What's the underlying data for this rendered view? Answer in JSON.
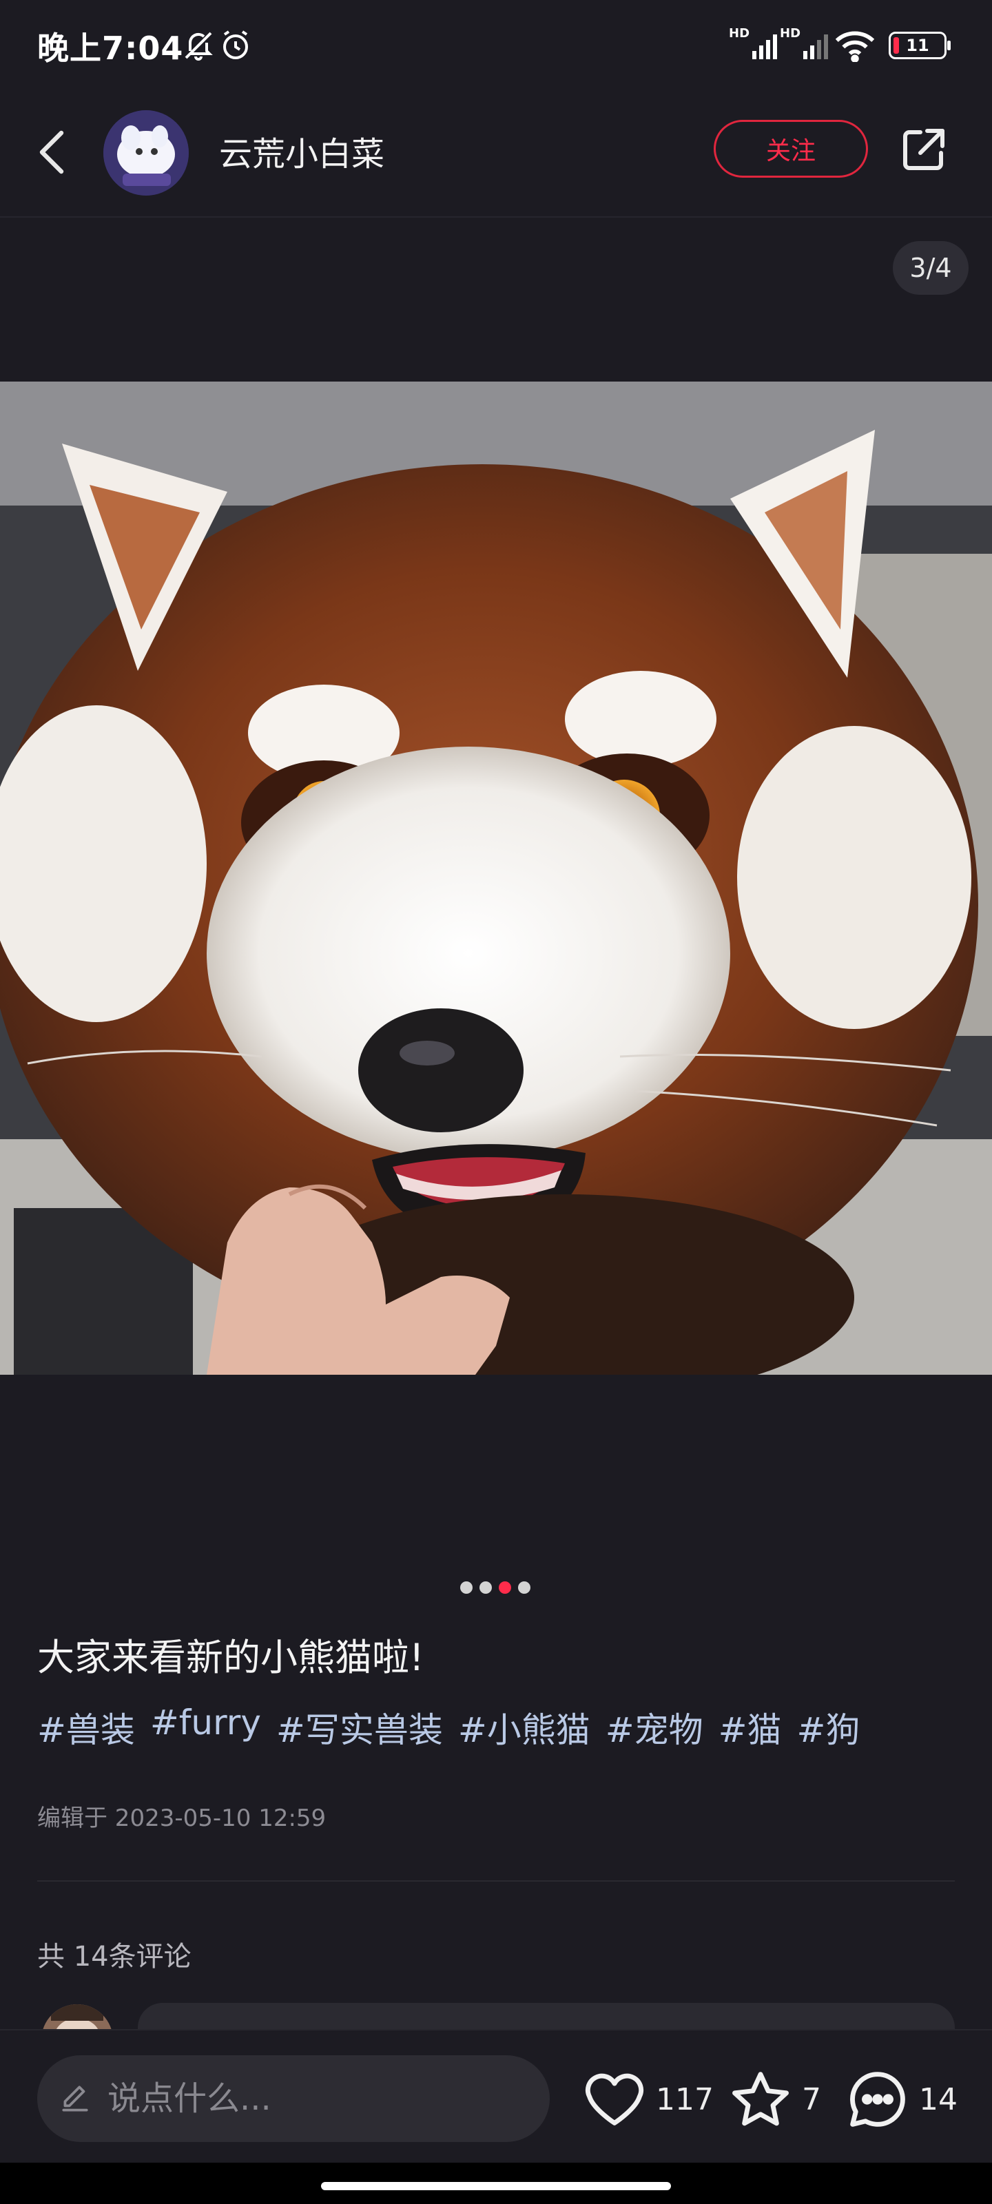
{
  "status": {
    "time": "晚上7:04",
    "network1": "HD",
    "network2": "HD",
    "battery": "11"
  },
  "header": {
    "author": "云荒小白菜",
    "follow_label": "关注"
  },
  "image": {
    "counter": "3/4",
    "current": 3,
    "total": 4
  },
  "post": {
    "title": "大家来看新的小熊猫啦!",
    "tags": [
      "#兽装",
      "#furry",
      "#写实兽装",
      "#小熊猫",
      "#宠物",
      "#猫",
      "#狗"
    ],
    "edit_time": "编辑于 2023-05-10 12:59"
  },
  "comments": {
    "count_label": "共 14条评论"
  },
  "bottom": {
    "input_placeholder": "说点什么...",
    "likes": "117",
    "stars": "7",
    "comments": "14"
  },
  "colors": {
    "accent": "#ff2c4b",
    "background": "#1c1b22",
    "tag": "#b9c9e5"
  }
}
